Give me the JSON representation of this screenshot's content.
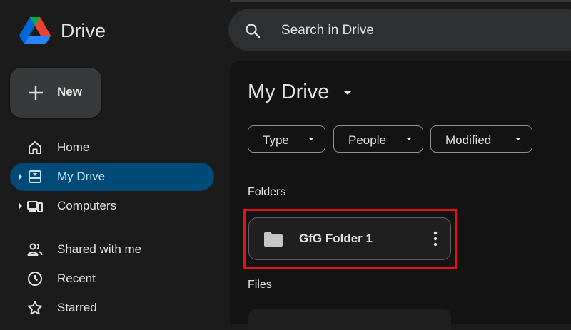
{
  "app": {
    "name": "Drive"
  },
  "sidebar": {
    "new_label": "New",
    "items": [
      {
        "label": "Home",
        "icon": "home-icon"
      },
      {
        "label": "My Drive",
        "icon": "my-drive-icon",
        "active": true
      },
      {
        "label": "Computers",
        "icon": "computers-icon"
      },
      {
        "label": "Shared with me",
        "icon": "shared-icon"
      },
      {
        "label": "Recent",
        "icon": "recent-icon"
      },
      {
        "label": "Starred",
        "icon": "star-icon"
      }
    ]
  },
  "search": {
    "placeholder": "Search in Drive"
  },
  "main": {
    "title": "My Drive",
    "filters": [
      {
        "label": "Type"
      },
      {
        "label": "People"
      },
      {
        "label": "Modified"
      }
    ],
    "folders_heading": "Folders",
    "folders": [
      {
        "name": "GfG Folder 1"
      }
    ],
    "files_heading": "Files"
  },
  "colors": {
    "background": "#1b1b1b",
    "main_surface": "#131314",
    "active_nav": "#004a77",
    "highlight_box": "#e3101a",
    "text": "#e3e3e3"
  }
}
